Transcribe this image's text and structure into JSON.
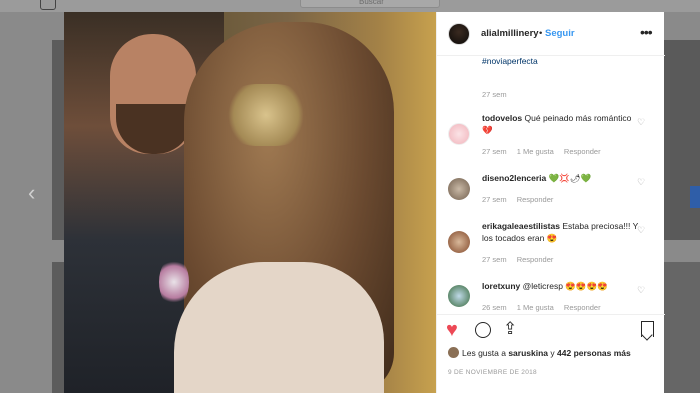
{
  "background": {
    "search_placeholder": "Buscar"
  },
  "header": {
    "username": "alialmillinery",
    "separator": "•",
    "follow_label": "Seguir",
    "more_label": "•••"
  },
  "caption": {
    "hashtag": "#noviaperfecta",
    "time": "27 sem"
  },
  "comments": [
    {
      "user": "todovelos",
      "text": "Qué peinado más romántico 💔",
      "time": "27 sem",
      "likes": "1 Me gusta",
      "reply": "Responder"
    },
    {
      "user": "diseno2lenceria",
      "text": "💚💢🌶💚",
      "time": "27 sem",
      "likes": "",
      "reply": "Responder"
    },
    {
      "user": "erikagaleaestilistas",
      "text": "Estaba preciosa!!! Y los tocados eran 😍",
      "time": "27 sem",
      "likes": "",
      "reply": "Responder"
    },
    {
      "user": "loretxuny",
      "text": "@leticresp 😍😍😍😍",
      "time": "26 sem",
      "likes": "1 Me gusta",
      "reply": "Responder"
    }
  ],
  "likes": {
    "prefix": "Les gusta a",
    "user": "saruskina",
    "middle": "y",
    "count_text": "442 personas más"
  },
  "date": "9 DE NOVIEMBRE DE 2018",
  "colors": {
    "accent": "#3897f0",
    "like": "#ed4956",
    "muted": "#999999"
  },
  "icons": [
    "heart-icon",
    "comment-icon",
    "share-icon",
    "bookmark-icon",
    "more-icon"
  ]
}
